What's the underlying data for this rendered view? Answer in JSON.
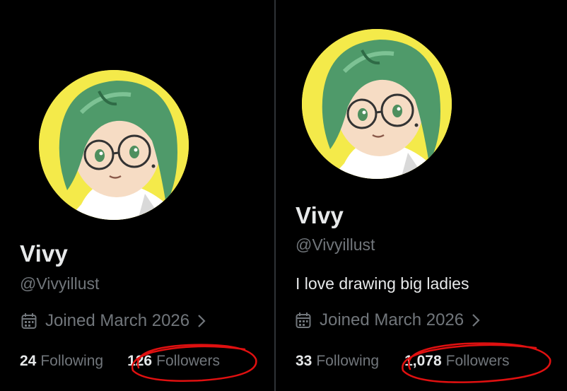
{
  "left": {
    "display_name": "Vivy",
    "handle": "@Vivyillust",
    "joined": "Joined March 2026",
    "following_count": "24",
    "following_label": "Following",
    "followers_count": "126",
    "followers_label": "Followers"
  },
  "right": {
    "display_name": "Vivy",
    "handle": "@Vivyillust",
    "bio": "I love drawing big ladies",
    "joined": "Joined March 2026",
    "following_count": "33",
    "following_label": "Following",
    "followers_count": "1,078",
    "followers_label": "Followers"
  },
  "icons": [
    "calendar-icon",
    "chevron-right-icon"
  ],
  "colors": {
    "background": "#000000",
    "primary_text": "#e7e9ea",
    "secondary_text": "#71767b",
    "avatar_bg": "#f4ea4a",
    "hair": "#4f9a6a",
    "annotation_red": "#e01010"
  }
}
